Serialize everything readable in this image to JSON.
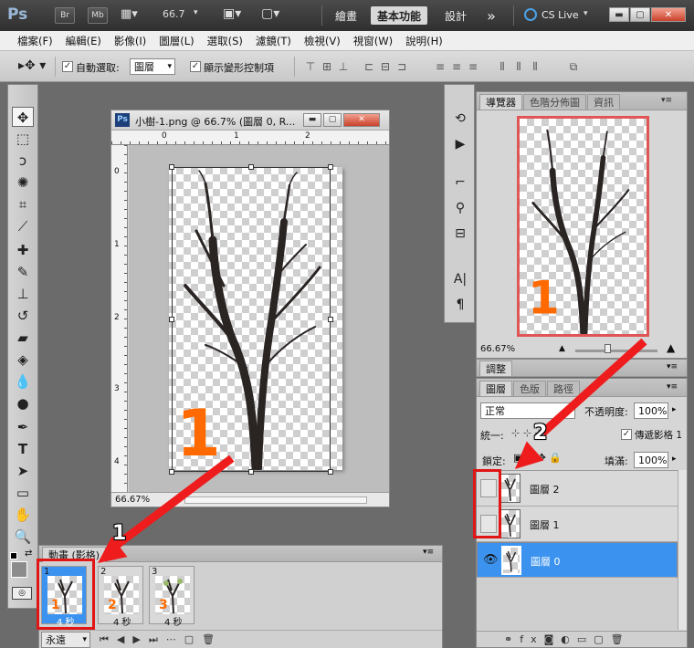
{
  "app": {
    "logo": "Ps",
    "bridge_label": "Br",
    "minibridge_label": "Mb",
    "zoom_value": "66.7",
    "workspaces": [
      "繪畫",
      "基本功能",
      "設計"
    ],
    "more": "»",
    "cs_live": "CS Live"
  },
  "menu": [
    "檔案(F)",
    "編輯(E)",
    "影像(I)",
    "圖層(L)",
    "選取(S)",
    "濾鏡(T)",
    "檢視(V)",
    "視窗(W)",
    "說明(H)"
  ],
  "options": {
    "auto_select_label": "自動選取:",
    "auto_select_value": "圖層",
    "transform_controls_label": "顯示變形控制項"
  },
  "document": {
    "title": "小樹-1.png @ 66.7% (圖層 0, R...",
    "ruler_h": [
      "0",
      "1",
      "2"
    ],
    "ruler_v": [
      "0",
      "1",
      "2",
      "3",
      "4"
    ],
    "zoom_status": "66.67%",
    "art_number": "1"
  },
  "navigator": {
    "tabs": [
      "導覽器",
      "色階分佈圖",
      "資訊"
    ],
    "zoom": "66.67%",
    "art_number": "1"
  },
  "adjustments": {
    "tab": "調整"
  },
  "layers": {
    "tabs": [
      "圖層",
      "色版",
      "路徑"
    ],
    "blend_mode": "正常",
    "opacity_label": "不透明度:",
    "opacity": "100%",
    "unify_label": "統一:",
    "propagate_label": "傳遞影格 1",
    "lock_label": "鎖定:",
    "fill_label": "填滿:",
    "fill": "100%",
    "items": [
      {
        "name": "圖層 2",
        "visible": false,
        "selected": false
      },
      {
        "name": "圖層 1",
        "visible": false,
        "selected": false
      },
      {
        "name": "圖層 0",
        "visible": true,
        "selected": true
      }
    ]
  },
  "animation": {
    "tab": "動畫 (影格)",
    "loop": "永遠",
    "frames": [
      {
        "num": "1",
        "delay": "4 秒",
        "label": "1",
        "selected": true
      },
      {
        "num": "2",
        "delay": "4 秒",
        "label": "2",
        "selected": false
      },
      {
        "num": "3",
        "delay": "4 秒",
        "label": "3",
        "selected": false
      }
    ]
  },
  "annotations": {
    "callout_1": "1",
    "callout_2": "2"
  },
  "colors": {
    "accent_red": "#e01515",
    "selection_blue": "#3c93ef",
    "orange": "#ff6a00"
  }
}
